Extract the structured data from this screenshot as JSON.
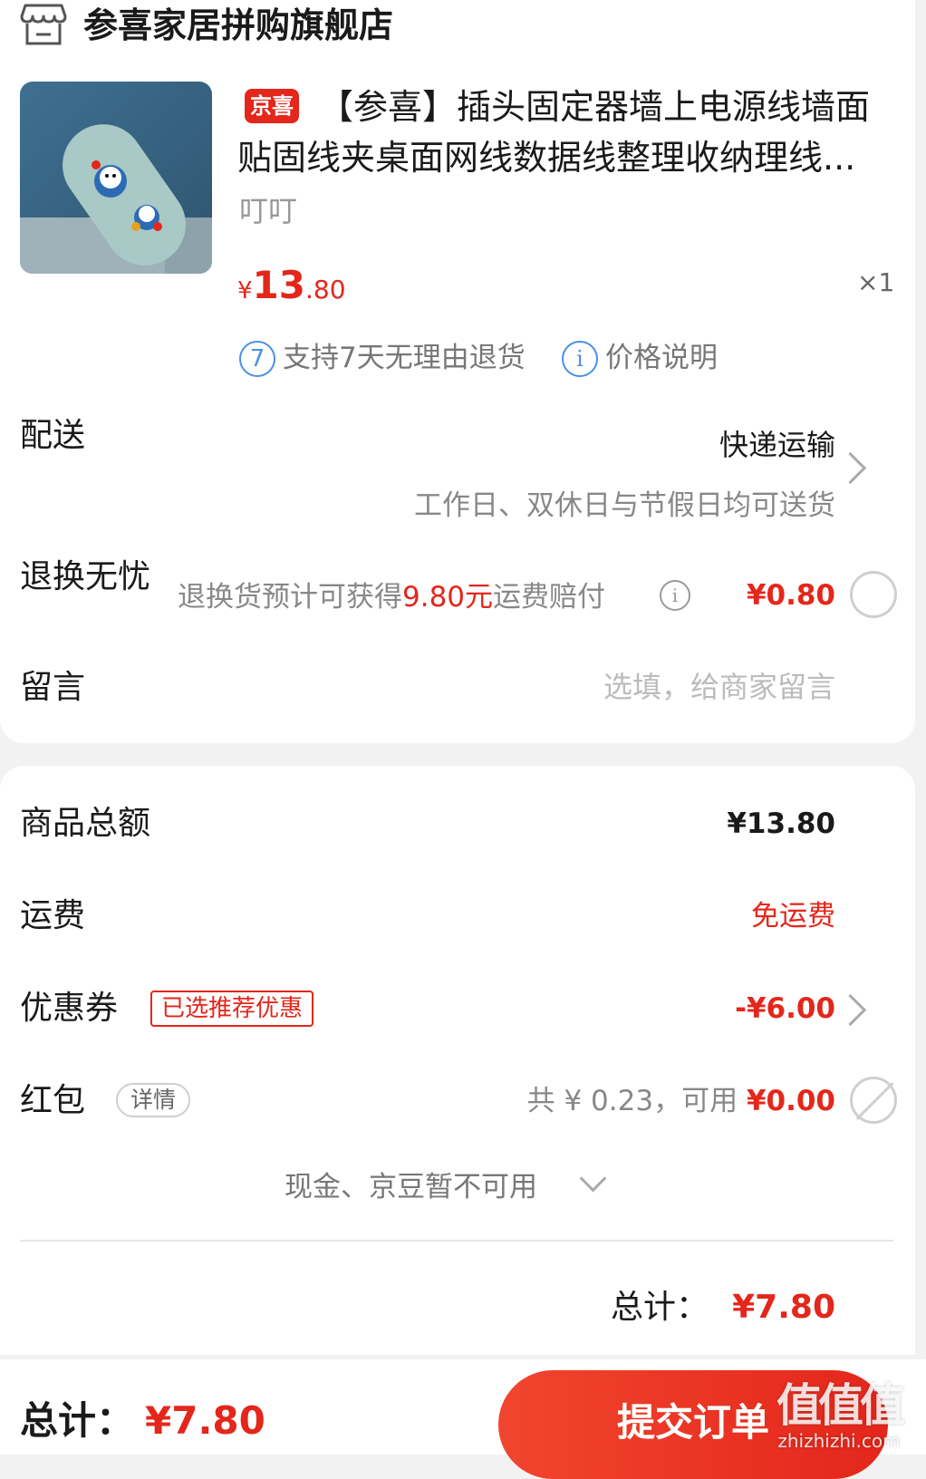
{
  "store": {
    "name": "参喜家居拼购旗舰店",
    "icon": "store-icon"
  },
  "product": {
    "tag": "京喜",
    "title_line1": "【参喜】插头固定器墙上电源线墙面",
    "title_line2": "贴固线夹桌面网线数据线整理收纳理线...",
    "variant": "叮叮",
    "price_symbol": "¥",
    "price_int": "13",
    "price_dec": ".80",
    "quantity": "×1",
    "service_7day_icon": "7",
    "service_7day": "支持7天无理由退货",
    "service_price_icon": "i",
    "service_price": "价格说明"
  },
  "delivery": {
    "label": "配送",
    "method": "快递运输",
    "note": "工作日、双休日与节假日均可送货"
  },
  "return_insurance": {
    "label": "退换无忧",
    "desc_pre": "退换货预计可获得",
    "desc_amount": "9.80元",
    "desc_post": "运费赔付",
    "price": "¥0.80"
  },
  "message": {
    "label": "留言",
    "placeholder": "选填，给商家留言"
  },
  "summary": {
    "goods_label": "商品总额",
    "goods_value": "¥13.80",
    "freight_label": "运费",
    "freight_value": "免运费",
    "coupon_label": "优惠券",
    "coupon_tag": "已选推荐优惠",
    "coupon_value": "-¥6.00",
    "redpacket_label": "红包",
    "redpacket_tag": "详情",
    "redpacket_total": "共 ¥ 0.23，可用",
    "redpacket_value": "¥0.00",
    "cash_note": "现金、京豆暂不可用",
    "total_label": "总计：",
    "total_value": "¥7.80"
  },
  "bottom_bar": {
    "total_label": "总计：",
    "total_value": "¥7.80",
    "submit_label": "提交订单"
  },
  "watermark": {
    "big": "值值值",
    "small": "zhizhizhi.com"
  },
  "colors": {
    "accent": "#e4261b",
    "info_blue": "#4a8fe8"
  }
}
